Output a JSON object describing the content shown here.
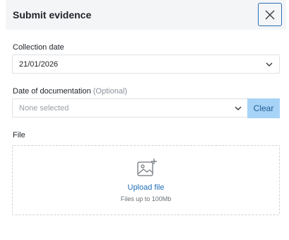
{
  "dialog": {
    "title": "Submit evidence",
    "close_icon": "close-icon"
  },
  "collection_date": {
    "label": "Collection date",
    "value": "21/01/2026",
    "icon": "chevron-down-icon"
  },
  "documentation_date": {
    "label": "Date of documentation",
    "optional_label": "(Optional)",
    "placeholder": "None selected",
    "clear_label": "Clear",
    "icon": "chevron-down-icon"
  },
  "file": {
    "label": "File",
    "upload_label": "Upload file",
    "hint": "Files up to 100Mb",
    "icon": "image-add-icon"
  },
  "colors": {
    "accent": "#2d6fb3",
    "clear_button_bg": "#a7d3f7",
    "link": "#1f6fb8",
    "header_bg": "#f4f5f7"
  }
}
